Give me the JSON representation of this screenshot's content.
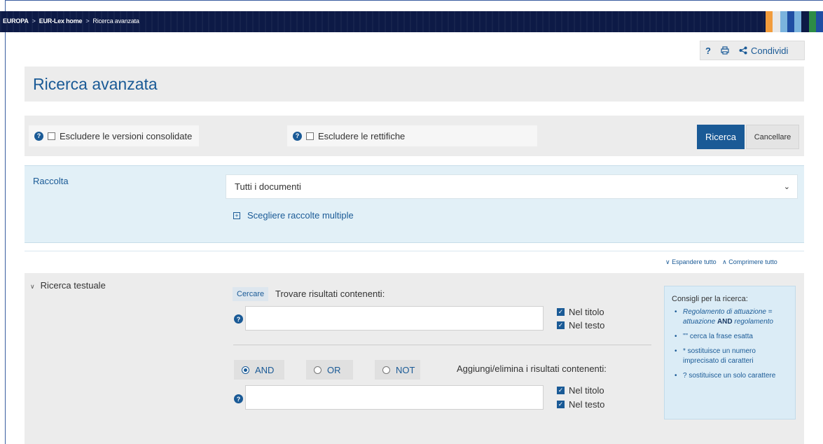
{
  "breadcrumb": {
    "items": [
      "EUROPA",
      "EUR-Lex home",
      "Ricerca avanzata"
    ]
  },
  "toolbar": {
    "help_label": "?",
    "share_label": "Condividi"
  },
  "page": {
    "title": "Ricerca avanzata"
  },
  "options": {
    "exclude_consolidated_label": "Escludere le versioni consolidate",
    "exclude_corrigenda_label": "Escludere le rettifiche",
    "search_button": "Ricerca",
    "clear_button": "Cancellare"
  },
  "collection": {
    "label": "Raccolta",
    "selected": "Tutti i documenti",
    "multiple_link": "Scegliere raccolte multiple"
  },
  "expand_controls": {
    "expand_all": "Espandere tutto",
    "collapse_all": "Comprimere tutto"
  },
  "text_search": {
    "section_label": "Ricerca testuale",
    "search_tag": "Cercare",
    "find_label": "Trovare risultati contenenti:",
    "in_title_label": "Nel titolo",
    "in_text_label": "Nel testo",
    "operators": [
      {
        "label": "AND",
        "selected": true
      },
      {
        "label": "OR",
        "selected": false
      },
      {
        "label": "NOT",
        "selected": false
      }
    ],
    "add_remove_label": "Aggiungi/elimina i risultati contenenti:"
  },
  "tips": {
    "heading": "Consigli per la ricerca:",
    "tip1_italic_a": "Regolamento di attuazione",
    "tip1_eq": "=",
    "tip1_italic_b": "attuazione",
    "tip1_bold": "AND",
    "tip1_italic_c": "regolamento",
    "tip2": "\"\" cerca la frase esatta",
    "tip3": "* sostituisce un numero imprecisato di caratteri",
    "tip4": "? sostituisce un solo carattere"
  },
  "colors": {
    "accent": "#1a5a96",
    "topbar": "#0d1a46",
    "panel_grey": "#ececec",
    "panel_blue": "#e2f0f7"
  }
}
